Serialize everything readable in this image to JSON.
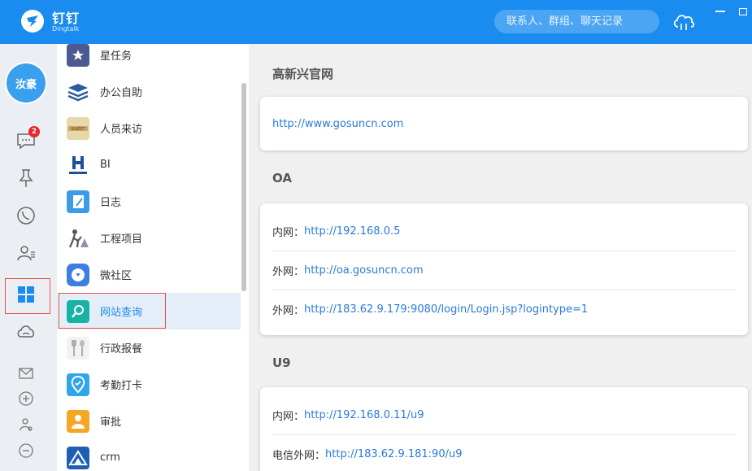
{
  "app": {
    "brand": "钉钉",
    "brand_sub": "Dingtalk",
    "search_placeholder": "联系人、群组、聊天记录"
  },
  "nav": {
    "avatar_text": "汝豪",
    "chat_badge": "2"
  },
  "apps": [
    {
      "label": "星任务",
      "icon": "star-task-icon",
      "color": "#4b5a91"
    },
    {
      "label": "办公自助",
      "icon": "office-stack-icon",
      "color": "#2c5aa0"
    },
    {
      "label": "人员来访",
      "icon": "guest-icon",
      "color": "#e8d7a8"
    },
    {
      "label": "BI",
      "icon": "bi-icon",
      "color": "#1d4f9a"
    },
    {
      "label": "日志",
      "icon": "log-icon",
      "color": "#3a9be8"
    },
    {
      "label": "工程项目",
      "icon": "construction-icon",
      "color": "#6c7688"
    },
    {
      "label": "微社区",
      "icon": "community-icon",
      "color": "#3d7fe0"
    },
    {
      "label": "网站查询",
      "icon": "website-search-icon",
      "color": "#19b3a6"
    },
    {
      "label": "行政报餐",
      "icon": "meal-icon",
      "color": "#b5b5b5"
    },
    {
      "label": "考勤打卡",
      "icon": "checkin-icon",
      "color": "#2fa6e8"
    },
    {
      "label": "审批",
      "icon": "approval-icon",
      "color": "#f5a623"
    },
    {
      "label": "crm",
      "icon": "crm-icon",
      "color": "#1d5fb5"
    }
  ],
  "sections": [
    {
      "title": "高新兴官网",
      "rows": [
        {
          "label": "",
          "link": "http://www.gosuncn.com"
        }
      ]
    },
    {
      "title": "OA",
      "rows": [
        {
          "label": "内网：",
          "link": "http://192.168.0.5"
        },
        {
          "label": "外网：",
          "link": "http://oa.gosuncn.com"
        },
        {
          "label": "外网：",
          "link": "http://183.62.9.179:9080/login/Login.jsp?logintype=1"
        }
      ]
    },
    {
      "title": "U9",
      "rows": [
        {
          "label": "内网：",
          "link": "http://192.168.0.11/u9"
        },
        {
          "label": "电信外网：",
          "link": "http://183.62.9.181:90/u9"
        }
      ]
    }
  ]
}
